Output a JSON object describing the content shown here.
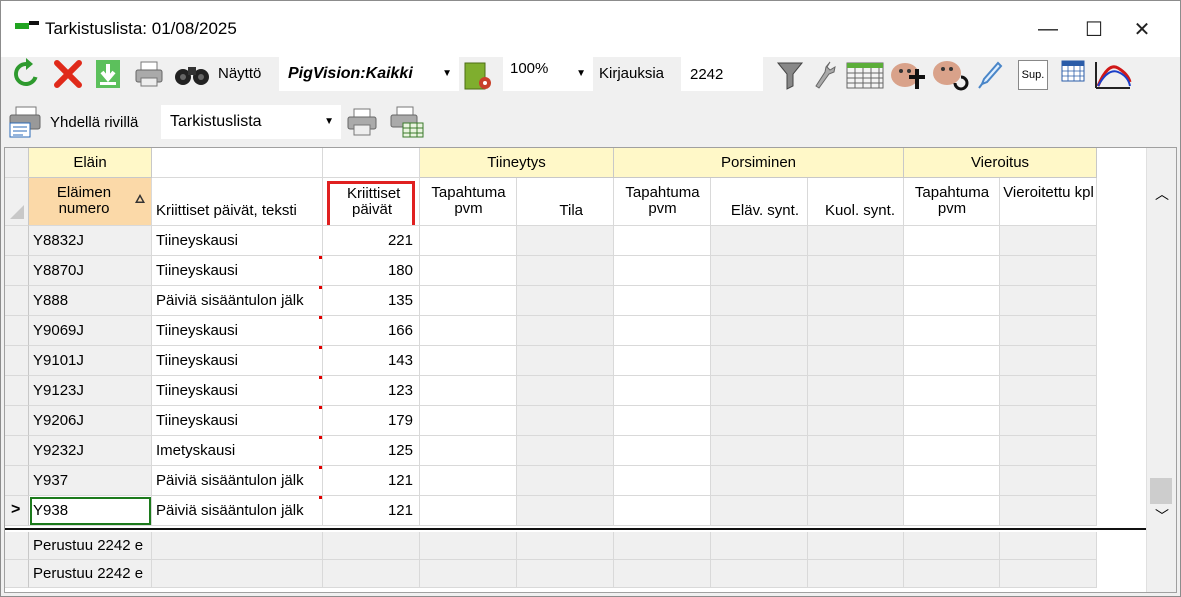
{
  "window": {
    "title": "Tarkistuslista: 01/08/2025",
    "minimize_glyph": "—",
    "maximize_glyph": "☐",
    "close_glyph": "✕"
  },
  "toolbar": {
    "view_label": "Näyttö",
    "view_value": "PigVision:Kaikki",
    "zoom_value": "100%",
    "records_label": "Kirjauksia",
    "records_value": "2242",
    "sup_label": "Sup.",
    "one_row_label": "Yhdellä rivillä",
    "list_value": "Tarkistuslista"
  },
  "grid": {
    "groups": {
      "animal": "Eläin",
      "pregnancy": "Tiineytys",
      "farrowing": "Porsiminen",
      "weaning": "Vieroitus"
    },
    "columns": {
      "animal_number": "Eläimen numero",
      "critical_text": "Kriittiset päivät, teksti",
      "critical_days": "Kriittiset päivät",
      "preg_event_date": "Tapahtuma pvm",
      "preg_status": "Tila",
      "farrow_event_date": "Tapahtuma pvm",
      "live_born": "Eläv. synt.",
      "dead_born": "Kuol. synt.",
      "wean_event_date": "Tapahtuma pvm",
      "weaned_count": "Vieroitettu kpl"
    },
    "rows": [
      {
        "id": "Y8832J",
        "text": "Tiineyskausi",
        "days": "221"
      },
      {
        "id": "Y8870J",
        "text": "Tiineyskausi",
        "days": "180"
      },
      {
        "id": "Y888",
        "text": "Päiviä sisääntulon jälk",
        "days": "135"
      },
      {
        "id": "Y9069J",
        "text": "Tiineyskausi",
        "days": "166"
      },
      {
        "id": "Y9101J",
        "text": "Tiineyskausi",
        "days": "143"
      },
      {
        "id": "Y9123J",
        "text": "Tiineyskausi",
        "days": "123"
      },
      {
        "id": "Y9206J",
        "text": "Tiineyskausi",
        "days": "179"
      },
      {
        "id": "Y9232J",
        "text": "Imetyskausi",
        "days": "125"
      },
      {
        "id": "Y937",
        "text": "Päiviä sisääntulon jälk",
        "days": "121"
      },
      {
        "id": "Y938",
        "text": "Päiviä sisääntulon jälk",
        "days": "121"
      }
    ],
    "current_row_marker": ">",
    "footer_rows": [
      "Perustuu 2242 e",
      "Perustuu 2242 e"
    ]
  },
  "colors": {
    "group_header_bg": "#fff8c8",
    "sorted_header_bg": "#fbd9a8",
    "highlight_border": "#e02020",
    "selected_cell_border": "#1c7a1c",
    "accent_red_mark": "#e00000"
  }
}
